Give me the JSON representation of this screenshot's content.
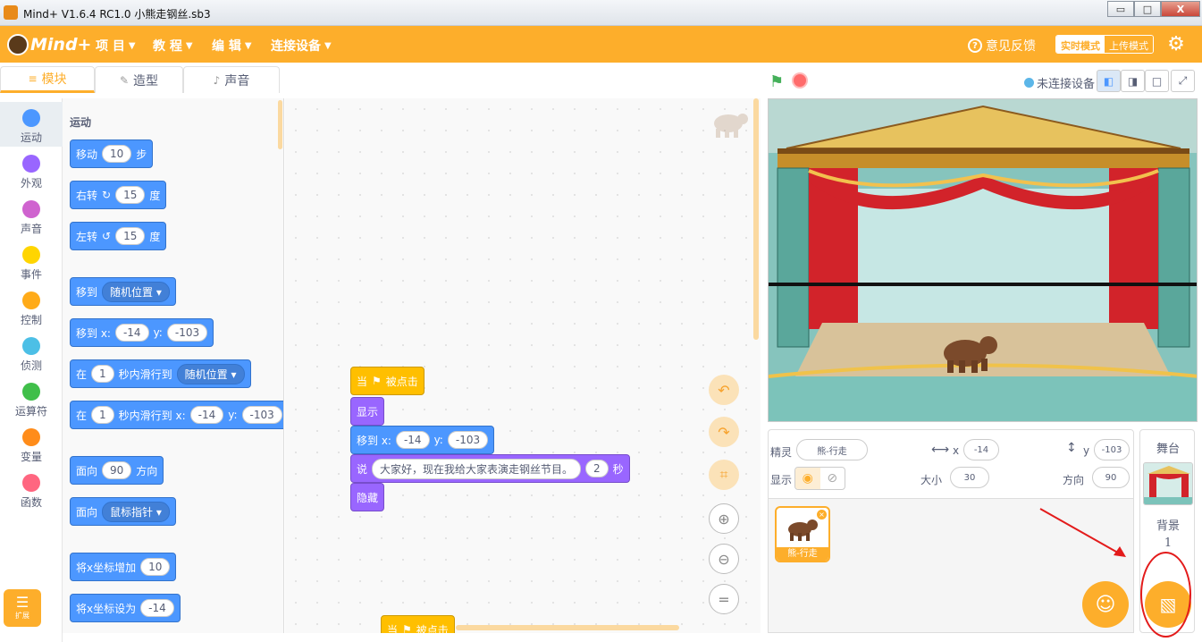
{
  "window": {
    "title": "Mind+ V1.6.4 RC1.0   小熊走钢丝.sb3",
    "minimize": "▭",
    "maximize": "□",
    "close": "X"
  },
  "menubar": {
    "logo_text": "Mind+",
    "menus": [
      "项 目",
      "教 程",
      "编 辑",
      "连接设备"
    ],
    "caret": "▼",
    "feedback": "意见反馈",
    "mode_live": "实时模式",
    "mode_upload": "上传模式",
    "settings_icon": "gear-icon"
  },
  "tabs": [
    {
      "label": "模块",
      "icon": "≡"
    },
    {
      "label": "造型",
      "icon": "✎"
    },
    {
      "label": "声音",
      "icon": "♪"
    }
  ],
  "categories": [
    {
      "label": "运动",
      "color": "#4c97ff"
    },
    {
      "label": "外观",
      "color": "#9966ff"
    },
    {
      "label": "声音",
      "color": "#cf63cf"
    },
    {
      "label": "事件",
      "color": "#ffd500"
    },
    {
      "label": "控制",
      "color": "#ffab19"
    },
    {
      "label": "侦测",
      "color": "#4cbfe6"
    },
    {
      "label": "运算符",
      "color": "#40bf4a"
    },
    {
      "label": "变量",
      "color": "#ff8c1a"
    },
    {
      "label": "函数",
      "color": "#ff6680"
    }
  ],
  "extension_label": "扩展",
  "palette": {
    "title": "运动",
    "blocks": [
      {
        "parts": [
          "移动",
          "#10",
          "步"
        ]
      },
      {
        "parts": [
          "右转",
          "↻",
          "#15",
          "度"
        ]
      },
      {
        "parts": [
          "左转",
          "↺",
          "#15",
          "度"
        ]
      },
      {
        "parts": [
          "移到",
          "v随机位置"
        ]
      },
      {
        "parts": [
          "移到 x:",
          "#-14",
          "y:",
          "#-103"
        ]
      },
      {
        "parts": [
          "在",
          "#1",
          "秒内滑行到",
          "v随机位置"
        ]
      },
      {
        "parts": [
          "在",
          "#1",
          "秒内滑行到 x:",
          "#-14",
          "y:",
          "#-103"
        ]
      },
      {
        "parts": [
          "面向",
          "#90",
          "方向"
        ]
      },
      {
        "parts": [
          "面向",
          "v鼠标指针"
        ]
      },
      {
        "parts": [
          "将x坐标增加",
          "#10"
        ]
      },
      {
        "parts": [
          "将x坐标设为",
          "#-14"
        ]
      }
    ]
  },
  "script": {
    "hat": [
      "当",
      "⚑",
      "被点击"
    ],
    "show": "显示",
    "goto": [
      "移到 x:",
      "#-14",
      "y:",
      "#-103"
    ],
    "say": [
      "说",
      "#大家好，现在我给大家表演走钢丝节目。",
      "#2",
      "秒"
    ],
    "hide": "隐藏",
    "hat2": [
      "当",
      "⚑",
      "被点击"
    ]
  },
  "stage_header": {
    "device_status": "未连接设备"
  },
  "sprite_info": {
    "sprite_label": "精灵",
    "sprite_name": "熊-行走",
    "x_label": "x",
    "x_value": "-14",
    "y_label": "y",
    "y_value": "-103",
    "show_label": "显示",
    "size_label": "大小",
    "size_value": "30",
    "direction_label": "方向",
    "direction_value": "90"
  },
  "sprite_list": {
    "sprite_name": "熊-行走"
  },
  "stage_selector": {
    "stage_label": "舞台",
    "backdrop_label": "背景",
    "backdrop_count": "1"
  },
  "colors": {
    "accent": "#fdae2b",
    "motion": "#4c97ff",
    "looks": "#9966ff",
    "events": "#ffbf00",
    "annotation": "#e31b1b"
  }
}
